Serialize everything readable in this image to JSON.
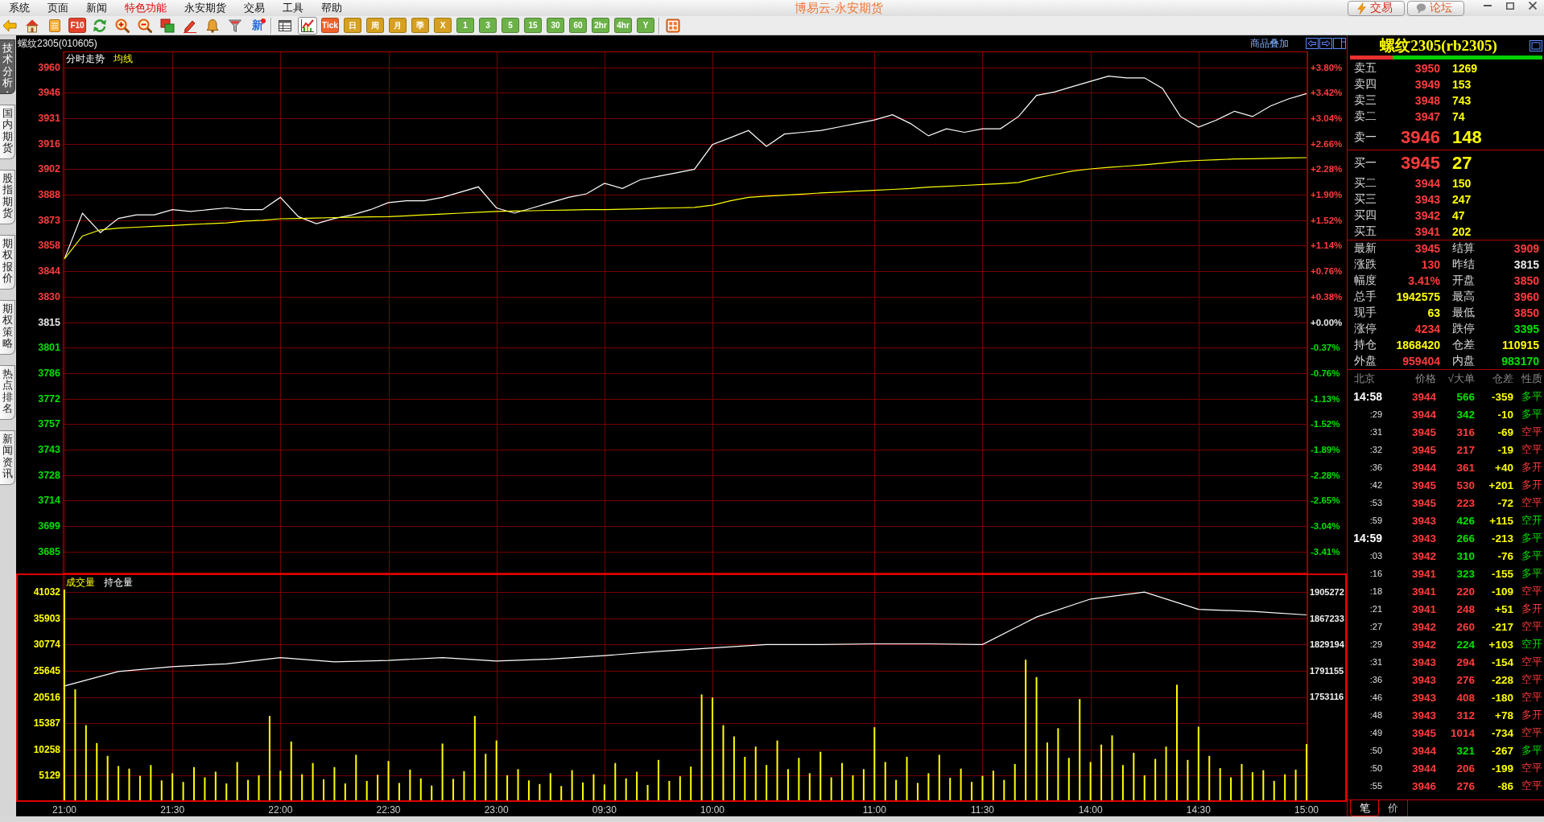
{
  "menu_bar": {
    "items": [
      {
        "label": "系统",
        "highlighted": false
      },
      {
        "label": "页面",
        "highlighted": false
      },
      {
        "label": "新闻",
        "highlighted": false
      },
      {
        "label": "特色功能",
        "highlighted": true
      },
      {
        "label": "永安期货",
        "highlighted": false
      },
      {
        "label": "交易",
        "highlighted": false
      },
      {
        "label": "工具",
        "highlighted": false
      },
      {
        "label": "帮助",
        "highlighted": false
      }
    ],
    "title": "博易云-永安期货",
    "buttons": [
      {
        "kind": "trade",
        "label": "交易"
      },
      {
        "kind": "forum",
        "label": "论坛"
      }
    ]
  },
  "toolbar": {
    "items": [
      {
        "kind": "back",
        "selected": false
      },
      {
        "kind": "home",
        "selected": false
      },
      {
        "kind": "notes",
        "selected": false
      },
      {
        "kind": "tile",
        "label": "F10",
        "color": "#e2442c",
        "selected": false
      },
      {
        "kind": "refresh",
        "selected": false
      },
      {
        "kind": "zoom-in",
        "selected": false
      },
      {
        "kind": "zoom-out",
        "selected": false
      },
      {
        "kind": "windows",
        "selected": false
      },
      {
        "kind": "pencil",
        "selected": false
      },
      {
        "kind": "bell",
        "selected": false
      },
      {
        "kind": "filter",
        "selected": false
      },
      {
        "kind": "news",
        "label": "新",
        "selected": false
      },
      {
        "kind": "separator"
      },
      {
        "kind": "table",
        "selected": false
      },
      {
        "kind": "line-chart",
        "selected": true
      },
      {
        "kind": "tile",
        "label": "Tick",
        "color": "#f0622c",
        "selected": false
      },
      {
        "kind": "tile",
        "label": "日",
        "color": "#d6a020",
        "selected": false
      },
      {
        "kind": "tile",
        "label": "周",
        "color": "#d6a020",
        "selected": false
      },
      {
        "kind": "tile",
        "label": "月",
        "color": "#d6a020",
        "selected": false
      },
      {
        "kind": "tile",
        "label": "季",
        "color": "#d6a020",
        "selected": false
      },
      {
        "kind": "tile",
        "label": "X",
        "color": "#d6a020",
        "selected": false
      },
      {
        "kind": "tile",
        "label": "1",
        "color": "#6cb248",
        "selected": false
      },
      {
        "kind": "tile",
        "label": "3",
        "color": "#6cb248",
        "selected": false
      },
      {
        "kind": "tile",
        "label": "5",
        "color": "#6cb248",
        "selected": false
      },
      {
        "kind": "tile",
        "label": "15",
        "color": "#6cb248",
        "selected": false
      },
      {
        "kind": "tile",
        "label": "30",
        "color": "#6cb248",
        "selected": false
      },
      {
        "kind": "tile",
        "label": "60",
        "color": "#6cb248",
        "selected": false
      },
      {
        "kind": "tile",
        "label": "2hr",
        "color": "#6cb248",
        "selected": false
      },
      {
        "kind": "tile",
        "label": "4hr",
        "color": "#6cb248",
        "selected": false
      },
      {
        "kind": "tile",
        "label": "Y",
        "color": "#6cb248",
        "selected": false
      },
      {
        "kind": "separator"
      },
      {
        "kind": "grid",
        "selected": false
      }
    ]
  },
  "side_tabs": [
    {
      "label": "技术分析",
      "selected": true
    },
    {
      "label": "国内期货",
      "selected": false
    },
    {
      "label": "股指期货",
      "selected": false
    },
    {
      "label": "期权报价",
      "selected": false
    },
    {
      "label": "期权策略",
      "selected": false
    },
    {
      "label": "热点排名",
      "selected": false
    },
    {
      "label": "新闻资讯",
      "selected": false
    }
  ],
  "chart_header": {
    "title": "螺纹2305(010605)",
    "overlay_link": "商品叠加"
  },
  "price_panel": {
    "percent_labels": [
      {
        "text": "+3.80%",
        "color": "#ff3c3c"
      },
      {
        "text": "+3.42%",
        "color": "#ff3c3c"
      },
      {
        "text": "+3.04%",
        "color": "#ff3c3c"
      },
      {
        "text": "+2.66%",
        "color": "#ff3c3c"
      },
      {
        "text": "+2.28%",
        "color": "#ff3c3c"
      },
      {
        "text": "+1.90%",
        "color": "#ff3c3c"
      },
      {
        "text": "+1.52%",
        "color": "#ff3c3c"
      },
      {
        "text": "+1.14%",
        "color": "#ff3c3c"
      },
      {
        "text": "+0.76%",
        "color": "#ff3c3c"
      },
      {
        "text": "+0.38%",
        "color": "#ff3c3c"
      },
      {
        "text": "+0.00%",
        "color": "#e8e8e8"
      },
      {
        "text": "-0.37%",
        "color": "#00e000"
      },
      {
        "text": "-0.76%",
        "color": "#00e000"
      },
      {
        "text": "-1.13%",
        "color": "#00e000"
      },
      {
        "text": "-1.52%",
        "color": "#00e000"
      },
      {
        "text": "-1.89%",
        "color": "#00e000"
      },
      {
        "text": "-2.28%",
        "color": "#00e000"
      },
      {
        "text": "-2.65%",
        "color": "#00e000"
      },
      {
        "text": "-3.04%",
        "color": "#00e000"
      },
      {
        "text": "-3.41%",
        "color": "#00e000"
      }
    ],
    "chart_data": {
      "type": "line",
      "grid": true,
      "ylim": [
        3672,
        3969
      ],
      "yticks": [
        {
          "value": 3960,
          "label": "3960"
        },
        {
          "value": 3945.5,
          "label": "3946"
        },
        {
          "value": 3931,
          "label": "3931"
        },
        {
          "value": 3916.5,
          "label": "3916"
        },
        {
          "value": 3902,
          "label": "3902"
        },
        {
          "value": 3887.5,
          "label": "3888"
        },
        {
          "value": 3873,
          "label": "3873"
        },
        {
          "value": 3858.5,
          "label": "3858"
        },
        {
          "value": 3844,
          "label": "3844"
        },
        {
          "value": 3829.5,
          "label": "3830"
        },
        {
          "value": 3815,
          "label": "3815"
        },
        {
          "value": 3800.5,
          "label": "3801"
        },
        {
          "value": 3786,
          "label": "3786"
        },
        {
          "value": 3771.5,
          "label": "3772"
        },
        {
          "value": 3757,
          "label": "3757"
        },
        {
          "value": 3742.5,
          "label": "3743"
        },
        {
          "value": 3728,
          "label": "3728"
        },
        {
          "value": 3713.5,
          "label": "3714"
        },
        {
          "value": 3699,
          "label": "3699"
        },
        {
          "value": 3684.5,
          "label": "3685"
        }
      ],
      "categories": [
        null,
        null,
        null,
        null,
        null,
        null,
        null,
        null,
        null,
        null,
        null,
        null,
        null,
        null,
        null,
        null,
        null,
        null,
        null,
        null,
        null,
        null,
        null,
        null,
        null,
        null,
        null,
        null,
        null,
        null,
        null,
        null,
        null,
        null,
        null,
        null,
        null,
        null,
        null,
        null,
        null,
        null,
        null,
        null,
        null,
        null,
        null,
        null,
        null,
        null,
        null,
        null,
        null,
        null,
        null,
        null,
        null,
        null,
        null,
        null,
        null,
        null,
        null,
        null,
        null,
        null,
        null,
        null,
        null,
        null
      ],
      "series": [
        {
          "name": "分时走势",
          "color": "#ffffff",
          "values": [
            3851,
            3877,
            3866,
            3874,
            3876,
            3876,
            3879,
            3878,
            3879,
            3880,
            3879,
            3879,
            3886,
            3875,
            3871,
            3874,
            3876,
            3879,
            3883,
            3884,
            3884,
            3886,
            3889,
            3892,
            3880,
            3877,
            3880,
            3883,
            3886,
            3888,
            3894,
            3891,
            3896,
            3898,
            3900,
            3902,
            3916,
            3920,
            3924,
            3915,
            3922,
            3923,
            3924,
            3926,
            3928,
            3930,
            3933,
            3928,
            3921,
            3925,
            3923,
            3925,
            3925,
            3932,
            3944,
            3946,
            3949,
            3952,
            3955,
            3954,
            3954,
            3948,
            3932,
            3926,
            3930,
            3935,
            3932,
            3938,
            3942,
            3945
          ]
        },
        {
          "name": "均线",
          "color": "#ffff00",
          "values": [
            3851,
            3864,
            3867.5,
            3868.5,
            3869,
            3869.5,
            3870,
            3870.5,
            3871,
            3871.5,
            3872.5,
            3873,
            3873.8,
            3874,
            3874.2,
            3874.5,
            3874.7,
            3874.9,
            3875,
            3875.5,
            3876,
            3876.5,
            3877,
            3877.5,
            3878,
            3878.2,
            3878.4,
            3878.6,
            3878.8,
            3879,
            3879,
            3879.2,
            3879.5,
            3879.8,
            3880,
            3880.3,
            3881.5,
            3884,
            3886,
            3886.7,
            3887.2,
            3887.8,
            3888.5,
            3889,
            3889.5,
            3890,
            3890.5,
            3891,
            3891.8,
            3892.3,
            3892.8,
            3893.3,
            3893.8,
            3894.5,
            3897,
            3899,
            3901,
            3902.2,
            3903,
            3903.8,
            3904.5,
            3905.5,
            3906.5,
            3907,
            3907.4,
            3907.8,
            3908,
            3908.2,
            3908.4,
            3908.6
          ]
        }
      ]
    }
  },
  "volume_panel": {
    "chart_data": {
      "type": "bar",
      "grid": true,
      "ylim": [
        0,
        44648
      ],
      "yticks": [
        41032,
        35903,
        30774,
        25645,
        20516,
        15387,
        10258,
        5129
      ],
      "categories": [
        "21:00",
        null,
        null,
        null,
        null,
        null,
        null,
        null,
        null,
        null,
        "21:30",
        null,
        null,
        null,
        null,
        null,
        null,
        null,
        null,
        null,
        "22:00",
        null,
        null,
        null,
        null,
        null,
        null,
        null,
        null,
        null,
        "22:30",
        null,
        null,
        null,
        null,
        null,
        null,
        null,
        null,
        null,
        "23:00",
        null,
        null,
        null,
        null,
        null,
        null,
        null,
        null,
        null,
        "09:30",
        null,
        null,
        null,
        null,
        null,
        null,
        null,
        null,
        null,
        "10:00",
        null,
        null,
        null,
        null,
        null,
        null,
        null,
        null,
        null,
        null,
        null,
        null,
        null,
        null,
        "11:00",
        null,
        null,
        null,
        null,
        null,
        null,
        null,
        null,
        null,
        "11:30",
        null,
        null,
        null,
        null,
        null,
        null,
        null,
        null,
        null,
        "14:00",
        null,
        null,
        null,
        null,
        null,
        null,
        null,
        null,
        null,
        "14:30",
        null,
        null,
        null,
        null,
        null,
        null,
        null,
        null,
        null,
        "15:00"
      ],
      "series": [
        {
          "name": "成交量",
          "color": "#ffff00",
          "values": [
            41500,
            22000,
            15000,
            11500,
            9000,
            7000,
            6500,
            5100,
            7200,
            4200,
            5600,
            3900,
            6800,
            4800,
            5900,
            3600,
            7800,
            4300,
            5200,
            16800,
            6100,
            11800,
            5400,
            7600,
            4400,
            6800,
            3600,
            9200,
            4100,
            5300,
            8000,
            3700,
            6300,
            4600,
            3200,
            11400,
            4500,
            6000,
            16800,
            9400,
            12000,
            5200,
            6400,
            4200,
            3500,
            5600,
            3100,
            6200,
            3800,
            5400,
            3400,
            7600,
            4600,
            5900,
            3300,
            8200,
            4100,
            5000,
            6900,
            21000,
            20400,
            15000,
            12800,
            8800,
            10800,
            7200,
            12000,
            6400,
            8600,
            5600,
            9800,
            4800,
            7600,
            5200,
            6400,
            14600,
            7800,
            4300,
            8800,
            3700,
            5600,
            9200,
            4700,
            6500,
            3900,
            5100,
            6100,
            4300,
            7400,
            27800,
            24400,
            11600,
            14400,
            8600,
            20100,
            7800,
            11200,
            13000,
            7200,
            9600,
            5200,
            8400,
            10800,
            22900,
            8200,
            14700,
            9000,
            6600,
            4800,
            7400,
            5800,
            6200,
            4100,
            5400,
            6300,
            11300
          ]
        }
      ]
    },
    "open_interest": {
      "chart_data": {
        "type": "line",
        "ylim": [
          1600700,
          1932100
        ],
        "yticks": [
          1905272,
          1867233,
          1829194,
          1791155,
          1753116
        ],
        "categories": [
          null,
          null,
          null,
          null,
          null,
          null,
          null,
          null,
          null,
          null,
          null,
          null,
          null,
          null,
          null,
          null,
          null,
          null,
          null,
          null,
          null,
          null,
          null,
          null
        ],
        "series": [
          {
            "name": "持仓量",
            "color": "#ffffff",
            "values": [
              1769000,
              1790000,
              1797000,
              1801000,
              1810000,
              1804000,
              1806000,
              1810000,
              1805000,
              1808000,
              1813000,
              1819000,
              1824000,
              1829000,
              1829000,
              1830000,
              1830000,
              1829000,
              1869000,
              1895000,
              1905000,
              1880000,
              1877000,
              1872000
            ]
          }
        ]
      }
    }
  },
  "quote": {
    "title": "螺纹2305(rb2305)",
    "ratio_bar": {
      "level": 0.22
    },
    "asks": [
      {
        "label": "卖五",
        "price": "3950",
        "volume": "1269",
        "kind": "normal"
      },
      {
        "label": "卖四",
        "price": "3949",
        "volume": "153",
        "kind": "normal"
      },
      {
        "label": "卖三",
        "price": "3948",
        "volume": "743",
        "kind": "normal"
      },
      {
        "label": "卖二",
        "price": "3947",
        "volume": "74",
        "kind": "normal"
      },
      {
        "label": "卖一",
        "price": "3946",
        "volume": "148",
        "kind": "best"
      }
    ],
    "bids": [
      {
        "label": "买一",
        "price": "3945",
        "volume": "27",
        "kind": "best"
      },
      {
        "label": "买二",
        "price": "3944",
        "volume": "150",
        "kind": "normal"
      },
      {
        "label": "买三",
        "price": "3943",
        "volume": "247",
        "kind": "normal"
      },
      {
        "label": "买四",
        "price": "3942",
        "volume": "47",
        "kind": "normal"
      },
      {
        "label": "买五",
        "price": "3941",
        "volume": "202",
        "kind": "normal"
      }
    ],
    "stats": [
      {
        "label": "最新",
        "value": "3945",
        "color": "#ff3c3c"
      },
      {
        "label": "结算",
        "value": "3909",
        "color": "#ff3c3c"
      },
      {
        "label": "涨跌",
        "value": "130",
        "color": "#ff3c3c"
      },
      {
        "label": "昨结",
        "value": "3815",
        "color": "#e8e8e8"
      },
      {
        "label": "幅度",
        "value": "3.41%",
        "color": "#ff3c3c"
      },
      {
        "label": "开盘",
        "value": "3850",
        "color": "#ff3c3c"
      },
      {
        "label": "总手",
        "value": "1942575",
        "color": "#ffff00"
      },
      {
        "label": "最高",
        "value": "3960",
        "color": "#ff3c3c"
      },
      {
        "label": "现手",
        "value": "63",
        "color": "#ffff00"
      },
      {
        "label": "最低",
        "value": "3850",
        "color": "#ff3c3c"
      },
      {
        "label": "涨停",
        "value": "4234",
        "color": "#ff3c3c"
      },
      {
        "label": "跌停",
        "value": "3395",
        "color": "#00e000"
      },
      {
        "label": "持仓",
        "value": "1868420",
        "color": "#ffff00"
      },
      {
        "label": "仓差",
        "value": "110915",
        "color": "#ffff00"
      },
      {
        "label": "外盘",
        "value": "959404",
        "color": "#ff3c3c"
      },
      {
        "label": "内盘",
        "value": "983170",
        "color": "#00e000"
      }
    ],
    "trades": {
      "columns": [
        "北京",
        "价格",
        "√大单",
        "仓差",
        "性质"
      ],
      "rows": [
        {
          "time": "14:58",
          "kind": "minute",
          "price": "3944",
          "volume": "566",
          "oi_change": "-359",
          "type": "多平",
          "color": "#00e000"
        },
        {
          "time": ":29",
          "kind": "second",
          "price": "3944",
          "volume": "342",
          "oi_change": "-10",
          "type": "多平",
          "color": "#00e000"
        },
        {
          "time": ":31",
          "kind": "second",
          "price": "3945",
          "volume": "316",
          "oi_change": "-69",
          "type": "空平",
          "color": "#ff3c3c"
        },
        {
          "time": ":32",
          "kind": "second",
          "price": "3945",
          "volume": "217",
          "oi_change": "-19",
          "type": "空平",
          "color": "#ff3c3c"
        },
        {
          "time": ":36",
          "kind": "second",
          "price": "3944",
          "volume": "361",
          "oi_change": "+40",
          "type": "多开",
          "color": "#ff3c3c"
        },
        {
          "time": ":42",
          "kind": "second",
          "price": "3945",
          "volume": "530",
          "oi_change": "+201",
          "type": "多开",
          "color": "#ff3c3c"
        },
        {
          "time": ":53",
          "kind": "second",
          "price": "3945",
          "volume": "223",
          "oi_change": "-72",
          "type": "空平",
          "color": "#ff3c3c"
        },
        {
          "time": ":59",
          "kind": "second",
          "price": "3943",
          "volume": "426",
          "oi_change": "+115",
          "type": "空开",
          "color": "#00e000"
        },
        {
          "time": "14:59",
          "kind": "minute",
          "price": "3943",
          "volume": "266",
          "oi_change": "-213",
          "type": "多平",
          "color": "#00e000"
        },
        {
          "time": ":03",
          "kind": "second",
          "price": "3942",
          "volume": "310",
          "oi_change": "-76",
          "type": "多平",
          "color": "#00e000"
        },
        {
          "time": ":16",
          "kind": "second",
          "price": "3941",
          "volume": "323",
          "oi_change": "-155",
          "type": "多平",
          "color": "#00e000"
        },
        {
          "time": ":18",
          "kind": "second",
          "price": "3941",
          "volume": "220",
          "oi_change": "-109",
          "type": "空平",
          "color": "#ff3c3c"
        },
        {
          "time": ":21",
          "kind": "second",
          "price": "3941",
          "volume": "248",
          "oi_change": "+51",
          "type": "多开",
          "color": "#ff3c3c"
        },
        {
          "time": ":27",
          "kind": "second",
          "price": "3942",
          "volume": "260",
          "oi_change": "-217",
          "type": "空平",
          "color": "#ff3c3c"
        },
        {
          "time": ":29",
          "kind": "second",
          "price": "3942",
          "volume": "224",
          "oi_change": "+103",
          "type": "空开",
          "color": "#00e000"
        },
        {
          "time": ":31",
          "kind": "second",
          "price": "3943",
          "volume": "294",
          "oi_change": "-154",
          "type": "空平",
          "color": "#ff3c3c"
        },
        {
          "time": ":36",
          "kind": "second",
          "price": "3943",
          "volume": "276",
          "oi_change": "-228",
          "type": "空平",
          "color": "#ff3c3c"
        },
        {
          "time": ":46",
          "kind": "second",
          "price": "3943",
          "volume": "408",
          "oi_change": "-180",
          "type": "空平",
          "color": "#ff3c3c"
        },
        {
          "time": ":48",
          "kind": "second",
          "price": "3943",
          "volume": "312",
          "oi_change": "+78",
          "type": "多开",
          "color": "#ff3c3c"
        },
        {
          "time": ":49",
          "kind": "second",
          "price": "3945",
          "volume": "1014",
          "oi_change": "-734",
          "type": "空平",
          "color": "#ff3c3c"
        },
        {
          "time": ":50",
          "kind": "second",
          "price": "3944",
          "volume": "321",
          "oi_change": "-267",
          "type": "多平",
          "color": "#00e000"
        },
        {
          "time": ":50",
          "kind": "second",
          "price": "3944",
          "volume": "206",
          "oi_change": "-199",
          "type": "空平",
          "color": "#ff3c3c"
        },
        {
          "time": ":55",
          "kind": "second",
          "price": "3946",
          "volume": "276",
          "oi_change": "-86",
          "type": "空平",
          "color": "#ff3c3c"
        }
      ]
    },
    "tabs": [
      {
        "label": "笔",
        "selected": true
      },
      {
        "label": "价",
        "selected": false
      }
    ]
  }
}
